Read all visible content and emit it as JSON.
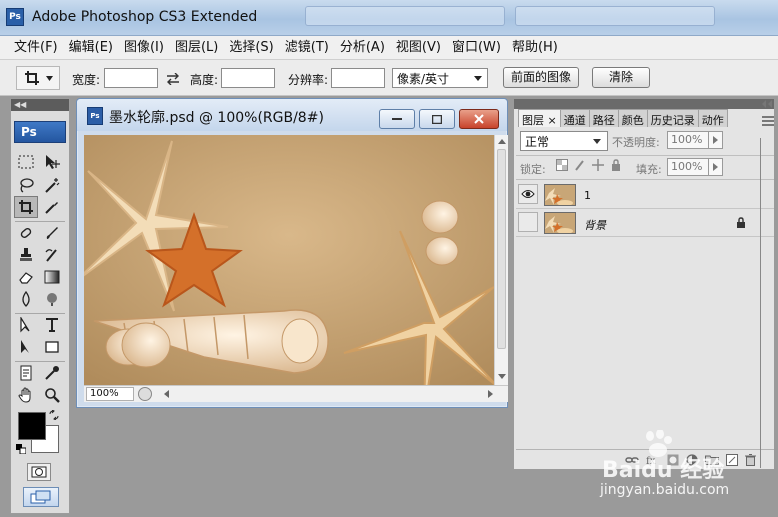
{
  "window": {
    "title": "Adobe Photoshop CS3 Extended",
    "app_logo": "Ps"
  },
  "menubar": {
    "items": [
      "文件(F)",
      "编辑(E)",
      "图像(I)",
      "图层(L)",
      "选择(S)",
      "滤镜(T)",
      "分析(A)",
      "视图(V)",
      "窗口(W)",
      "帮助(H)"
    ]
  },
  "options_bar": {
    "width_label": "宽度:",
    "width_value": "",
    "height_label": "高度:",
    "height_value": "",
    "resolution_label": "分辨率:",
    "resolution_value": "",
    "unit_select": "像素/英寸",
    "front_image_button": "前面的图像",
    "clear_button": "清除"
  },
  "tools_panel": {
    "badge": "Ps",
    "foreground_color": "#000000",
    "background_color": "#ffffff"
  },
  "document": {
    "title": "墨水轮廓.psd @ 100%(RGB/8#)",
    "icon": "Ps",
    "zoom": "100%"
  },
  "layers_panel": {
    "tabs": [
      "图层",
      "通道",
      "路径",
      "颜色",
      "历史记录",
      "动作"
    ],
    "tab_close": "×",
    "blend_mode": "正常",
    "opacity_label": "不透明度:",
    "opacity_value": "100%",
    "lock_label": "锁定:",
    "fill_label": "填充:",
    "fill_value": "100%",
    "layers": [
      {
        "name": "1",
        "visible": true,
        "locked": false
      },
      {
        "name": "背景",
        "visible": false,
        "locked": true
      }
    ]
  },
  "watermark": {
    "text": "Baidu 经验",
    "url": "jingyan.baidu.com"
  },
  "colors": {
    "accent": "#2a5fa8",
    "close_button": "#c8432b",
    "canvas_sand": "#c8a677"
  }
}
